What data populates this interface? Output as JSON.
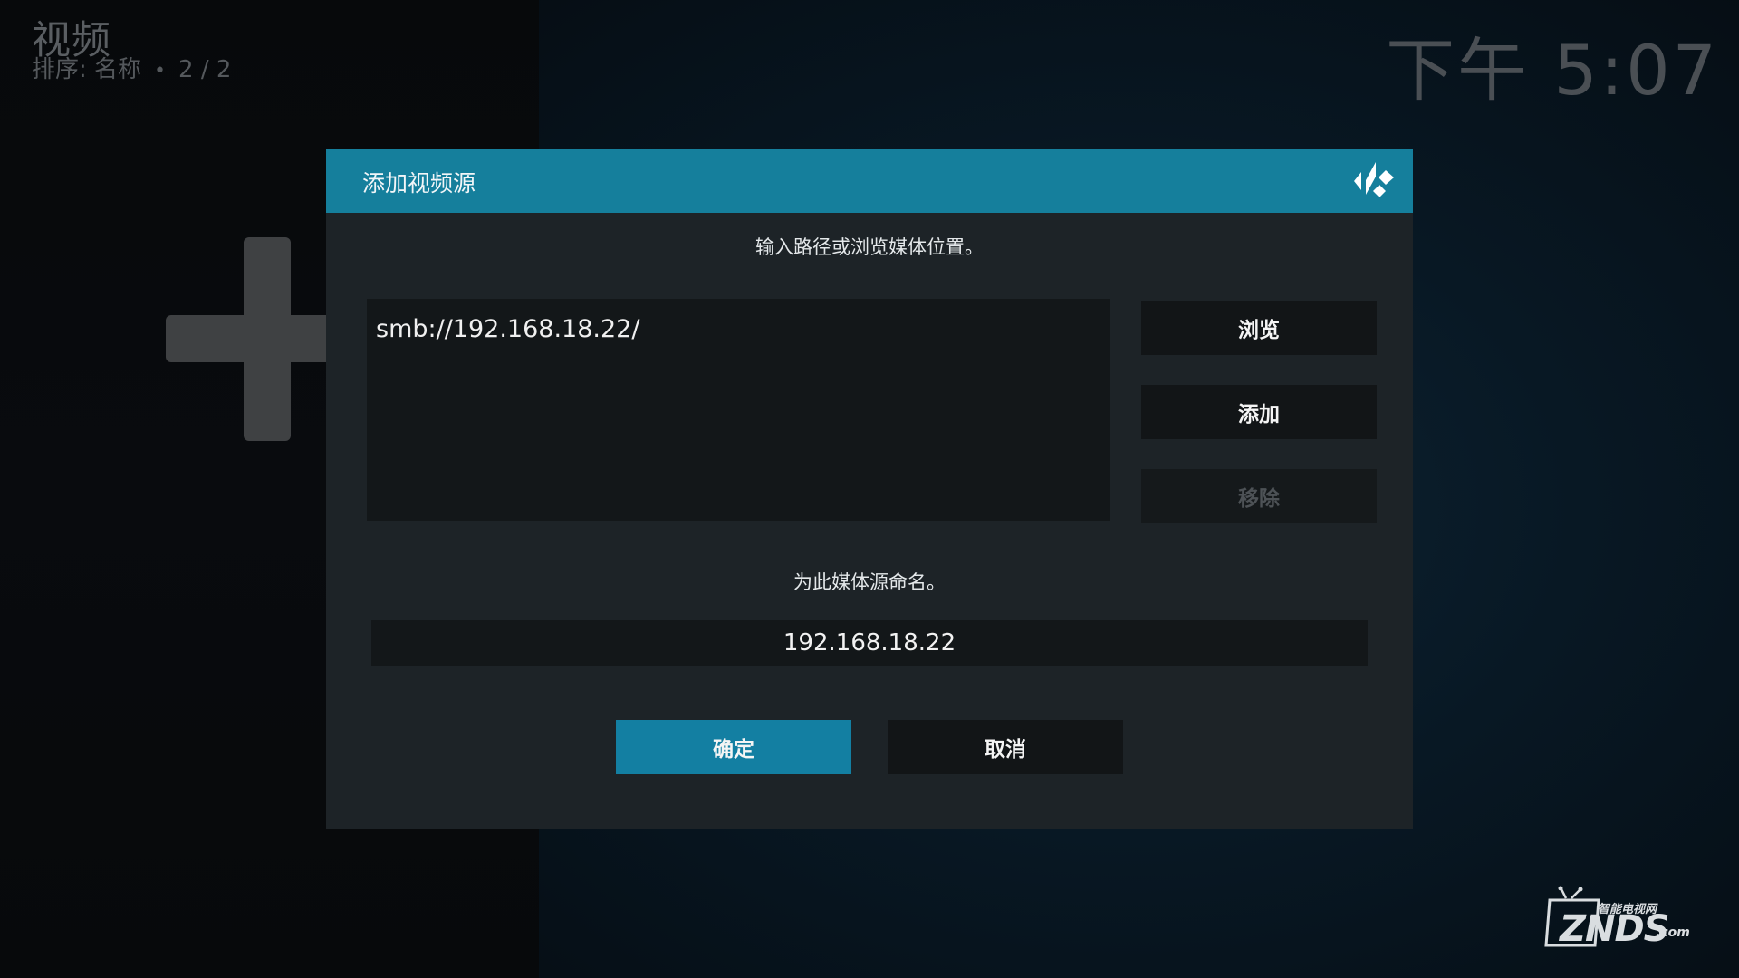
{
  "header": {
    "title": "视频",
    "sort_label": "排序: 名称",
    "dot": "•",
    "page": "2 / 2"
  },
  "clock": "下午 5:07",
  "background": {
    "icon": "plus-icon"
  },
  "dialog": {
    "title": "添加视频源",
    "logo_icon": "kodi-logo-icon",
    "path_prompt": "输入路径或浏览媒体位置。",
    "paths": [
      "smb://192.168.18.22/"
    ],
    "buttons": {
      "browse": "浏览",
      "add": "添加",
      "remove": "移除"
    },
    "name_prompt": "为此媒体源命名。",
    "name_value": "192.168.18.22",
    "ok": "确定",
    "cancel": "取消"
  },
  "watermark": {
    "brand": "ZNDS",
    "suffix": ".com",
    "tagline": "智能电视网"
  },
  "colors": {
    "accent": "#157f9c",
    "dialog_bg": "#1d2327",
    "button_bg": "#121517"
  }
}
